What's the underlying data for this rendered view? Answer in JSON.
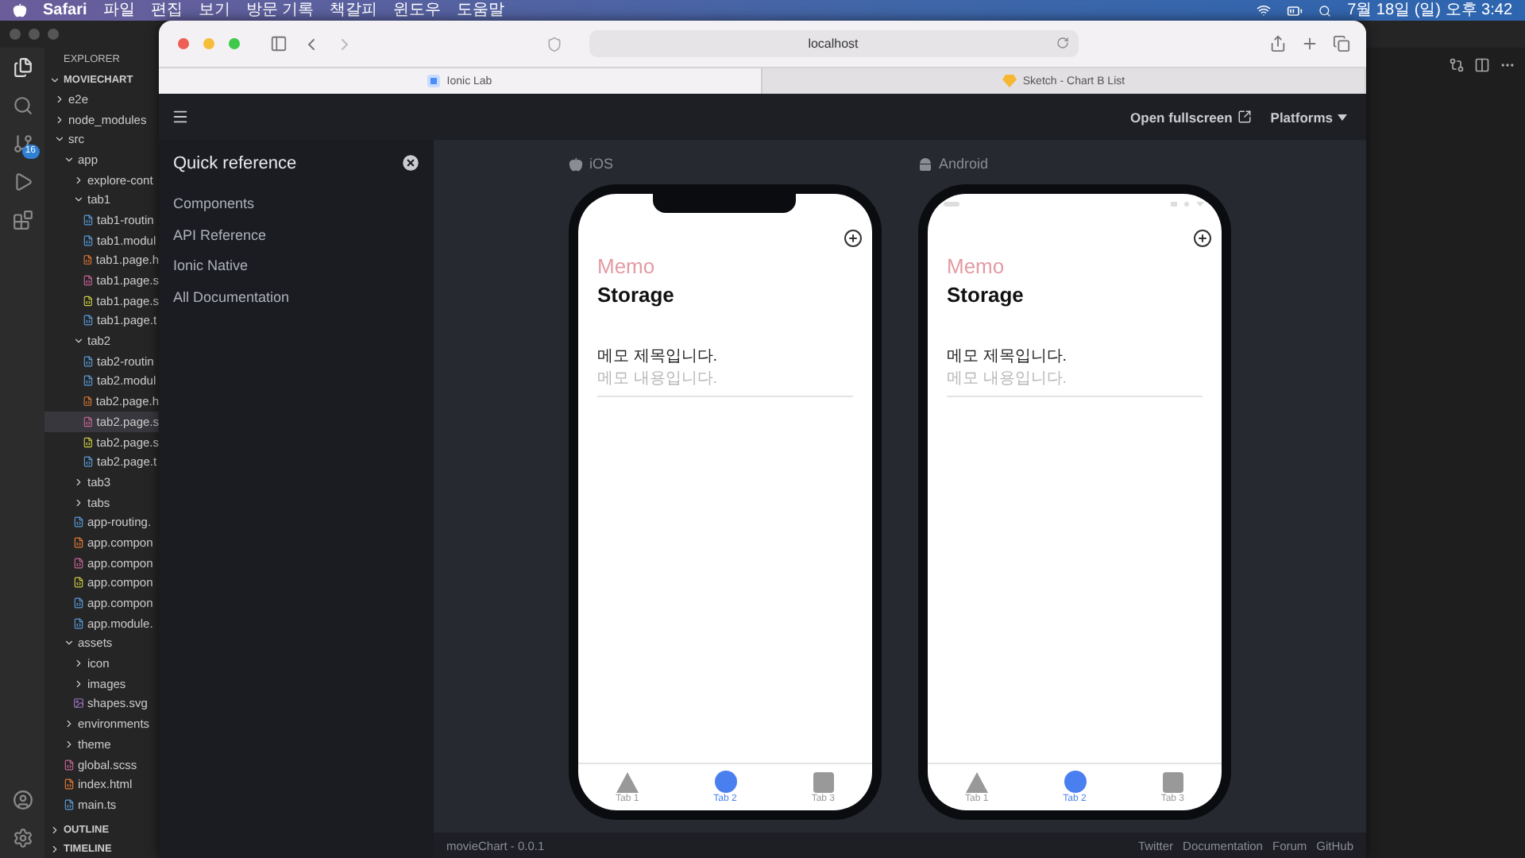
{
  "menu_bar": {
    "app": "Safari",
    "menus": [
      "파일",
      "편집",
      "보기",
      "방문 기록",
      "책갈피",
      "윈도우",
      "도움말"
    ],
    "clock": "7월 18일 (일) 오후 3:42"
  },
  "vscode": {
    "activity_badge": "16",
    "explorer_title": "EXPLORER",
    "project": "MOVIECHART",
    "tree": [
      {
        "name": "e2e",
        "kind": "folder",
        "expanded": false,
        "selected": false
      },
      {
        "name": "node_modules",
        "kind": "folder",
        "expanded": false,
        "selected": false
      },
      {
        "name": "src",
        "kind": "folder",
        "expanded": true,
        "selected": false,
        "children": [
          {
            "name": "app",
            "kind": "folder",
            "expanded": true,
            "selected": false,
            "children": [
              {
                "name": "explore-cont",
                "kind": "folder",
                "expanded": false,
                "selected": false
              },
              {
                "name": "tab1",
                "kind": "folder",
                "expanded": true,
                "selected": false,
                "children": [
                  {
                    "name": "tab1-routin",
                    "kind": "ts",
                    "selected": false
                  },
                  {
                    "name": "tab1.modul",
                    "kind": "ts",
                    "selected": false
                  },
                  {
                    "name": "tab1.page.h",
                    "kind": "html",
                    "selected": false
                  },
                  {
                    "name": "tab1.page.s",
                    "kind": "scss",
                    "selected": false
                  },
                  {
                    "name": "tab1.page.s",
                    "kind": "spec",
                    "selected": false
                  },
                  {
                    "name": "tab1.page.t",
                    "kind": "ts",
                    "selected": false
                  }
                ]
              },
              {
                "name": "tab2",
                "kind": "folder",
                "expanded": true,
                "selected": false,
                "children": [
                  {
                    "name": "tab2-routin",
                    "kind": "ts",
                    "selected": false
                  },
                  {
                    "name": "tab2.modul",
                    "kind": "ts",
                    "selected": false
                  },
                  {
                    "name": "tab2.page.h",
                    "kind": "html",
                    "selected": false
                  },
                  {
                    "name": "tab2.page.s",
                    "kind": "scss",
                    "selected": true
                  },
                  {
                    "name": "tab2.page.s",
                    "kind": "spec",
                    "selected": false
                  },
                  {
                    "name": "tab2.page.t",
                    "kind": "ts",
                    "selected": false
                  }
                ]
              },
              {
                "name": "tab3",
                "kind": "folder",
                "expanded": false,
                "selected": false
              },
              {
                "name": "tabs",
                "kind": "folder",
                "expanded": false,
                "selected": false
              },
              {
                "name": "app-routing.",
                "kind": "ts",
                "selected": false
              },
              {
                "name": "app.compon",
                "kind": "html",
                "selected": false
              },
              {
                "name": "app.compon",
                "kind": "scss",
                "selected": false
              },
              {
                "name": "app.compon",
                "kind": "spec",
                "selected": false
              },
              {
                "name": "app.compon",
                "kind": "ts",
                "selected": false
              },
              {
                "name": "app.module.",
                "kind": "ts",
                "selected": false
              }
            ]
          },
          {
            "name": "assets",
            "kind": "folder",
            "expanded": true,
            "selected": false,
            "children": [
              {
                "name": "icon",
                "kind": "folder",
                "expanded": false,
                "selected": false
              },
              {
                "name": "images",
                "kind": "folder",
                "expanded": false,
                "selected": false
              },
              {
                "name": "shapes.svg",
                "kind": "svg",
                "selected": false
              }
            ]
          },
          {
            "name": "environments",
            "kind": "folder",
            "expanded": false,
            "selected": false
          },
          {
            "name": "theme",
            "kind": "folder",
            "expanded": false,
            "selected": false
          },
          {
            "name": "global.scss",
            "kind": "scss",
            "selected": false
          },
          {
            "name": "index.html",
            "kind": "html",
            "selected": false
          },
          {
            "name": "main.ts",
            "kind": "ts",
            "selected": false
          }
        ]
      }
    ],
    "sections": [
      "OUTLINE",
      "TIMELINE"
    ]
  },
  "safari": {
    "address": "localhost",
    "tabs": [
      {
        "label": "Ionic Lab",
        "selected": true
      },
      {
        "label": "Sketch - Chart B List",
        "selected": false
      }
    ]
  },
  "ionic_lab": {
    "open_fullscreen": "Open fullscreen",
    "platforms": "Platforms",
    "sidebar": {
      "title": "Quick reference",
      "links": [
        "Components",
        "API Reference",
        "Ionic Native",
        "All Documentation"
      ]
    },
    "devices": [
      {
        "kind": "ios",
        "platform": "iOS",
        "title": "Memo",
        "heading": "Storage",
        "memos": [
          {
            "title": "메모 제목입니다.",
            "body": "메모 내용입니다."
          }
        ],
        "tabs": [
          {
            "label": "Tab 1",
            "kind": "triangle",
            "selected": false
          },
          {
            "label": "Tab 2",
            "kind": "circle",
            "selected": true
          },
          {
            "label": "Tab 3",
            "kind": "square",
            "selected": false
          }
        ]
      },
      {
        "kind": "android",
        "platform": "Android",
        "title": "Memo",
        "heading": "Storage",
        "memos": [
          {
            "title": "메모 제목입니다.",
            "body": "메모 내용입니다."
          }
        ],
        "tabs": [
          {
            "label": "Tab 1",
            "kind": "triangle",
            "selected": false
          },
          {
            "label": "Tab 2",
            "kind": "circle",
            "selected": true
          },
          {
            "label": "Tab 3",
            "kind": "square",
            "selected": false
          }
        ]
      }
    ],
    "footer": {
      "version": "movieChart - 0.0.1",
      "links": [
        "Twitter",
        "Documentation",
        "Forum",
        "GitHub"
      ]
    }
  }
}
